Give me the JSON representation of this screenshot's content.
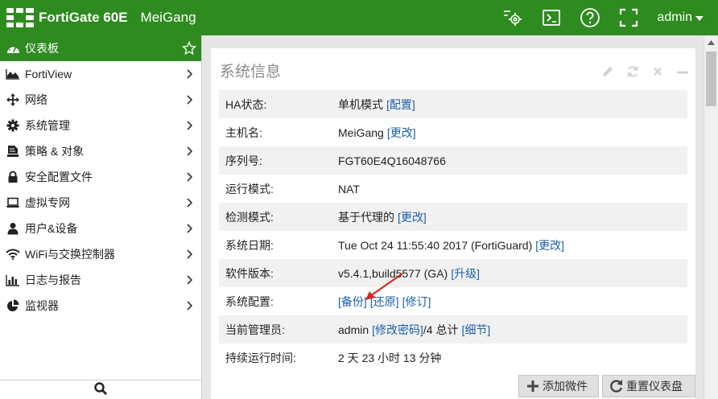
{
  "header": {
    "brand": "FortiGate 60E",
    "hostname": "MeiGang",
    "user": "admin",
    "icons": [
      "cli-settings-icon",
      "console-icon",
      "help-icon",
      "fullscreen-icon"
    ]
  },
  "sidebar": {
    "items": [
      {
        "label": "仪表板",
        "icon": "dashboard-icon",
        "active": true
      },
      {
        "label": "FortiView",
        "icon": "chart-area-icon"
      },
      {
        "label": "网络",
        "icon": "move-arrows-icon"
      },
      {
        "label": "系统管理",
        "icon": "gear-icon"
      },
      {
        "label": "策略 & 对象",
        "icon": "policy-icon"
      },
      {
        "label": "安全配置文件",
        "icon": "lock-icon"
      },
      {
        "label": "虚拟专网",
        "icon": "laptop-icon"
      },
      {
        "label": "用户&设备",
        "icon": "user-icon"
      },
      {
        "label": "WiFi与交换控制器",
        "icon": "wifi-icon"
      },
      {
        "label": "日志与报告",
        "icon": "bar-chart-icon"
      },
      {
        "label": "监视器",
        "icon": "pie-chart-icon"
      }
    ]
  },
  "widget": {
    "title": "系统信息",
    "rows": [
      {
        "label": "HA状态:",
        "value": "单机模式",
        "links": [
          "[配置]"
        ]
      },
      {
        "label": "主机名:",
        "value": "MeiGang",
        "links": [
          "[更改]"
        ]
      },
      {
        "label": "序列号:",
        "value": "FGT60E4Q16048766",
        "links": []
      },
      {
        "label": "运行模式:",
        "value": "NAT",
        "links": []
      },
      {
        "label": "检测模式:",
        "value": "基于代理的",
        "links": [
          "[更改]"
        ]
      },
      {
        "label": "系统日期:",
        "value": "Tue Oct 24 11:55:40 2017 (FortiGuard)",
        "links": [
          "[更改]"
        ]
      },
      {
        "label": "软件版本:",
        "value": "v5.4.1,build5577 (GA)",
        "links": [
          "[升级]"
        ]
      },
      {
        "label": "系统配置:",
        "value": "",
        "links": [
          "[备份]",
          "[还原]",
          "[修订]"
        ]
      },
      {
        "label": "当前管理员:",
        "value": "admin",
        "links": [
          "[修改密码]"
        ],
        "suffix": "/4 总计",
        "links2": [
          "[细节]"
        ]
      },
      {
        "label": "持续运行时间:",
        "value": "2 天 23 小时 13 分钟",
        "links": []
      }
    ]
  },
  "footer": {
    "add_widget": "添加微件",
    "reset_dashboard": "重置仪表盘"
  },
  "colors": {
    "brand_green": "#2e8b1f",
    "link_blue": "#1a5ea8",
    "annotation_red": "#d9251c"
  }
}
